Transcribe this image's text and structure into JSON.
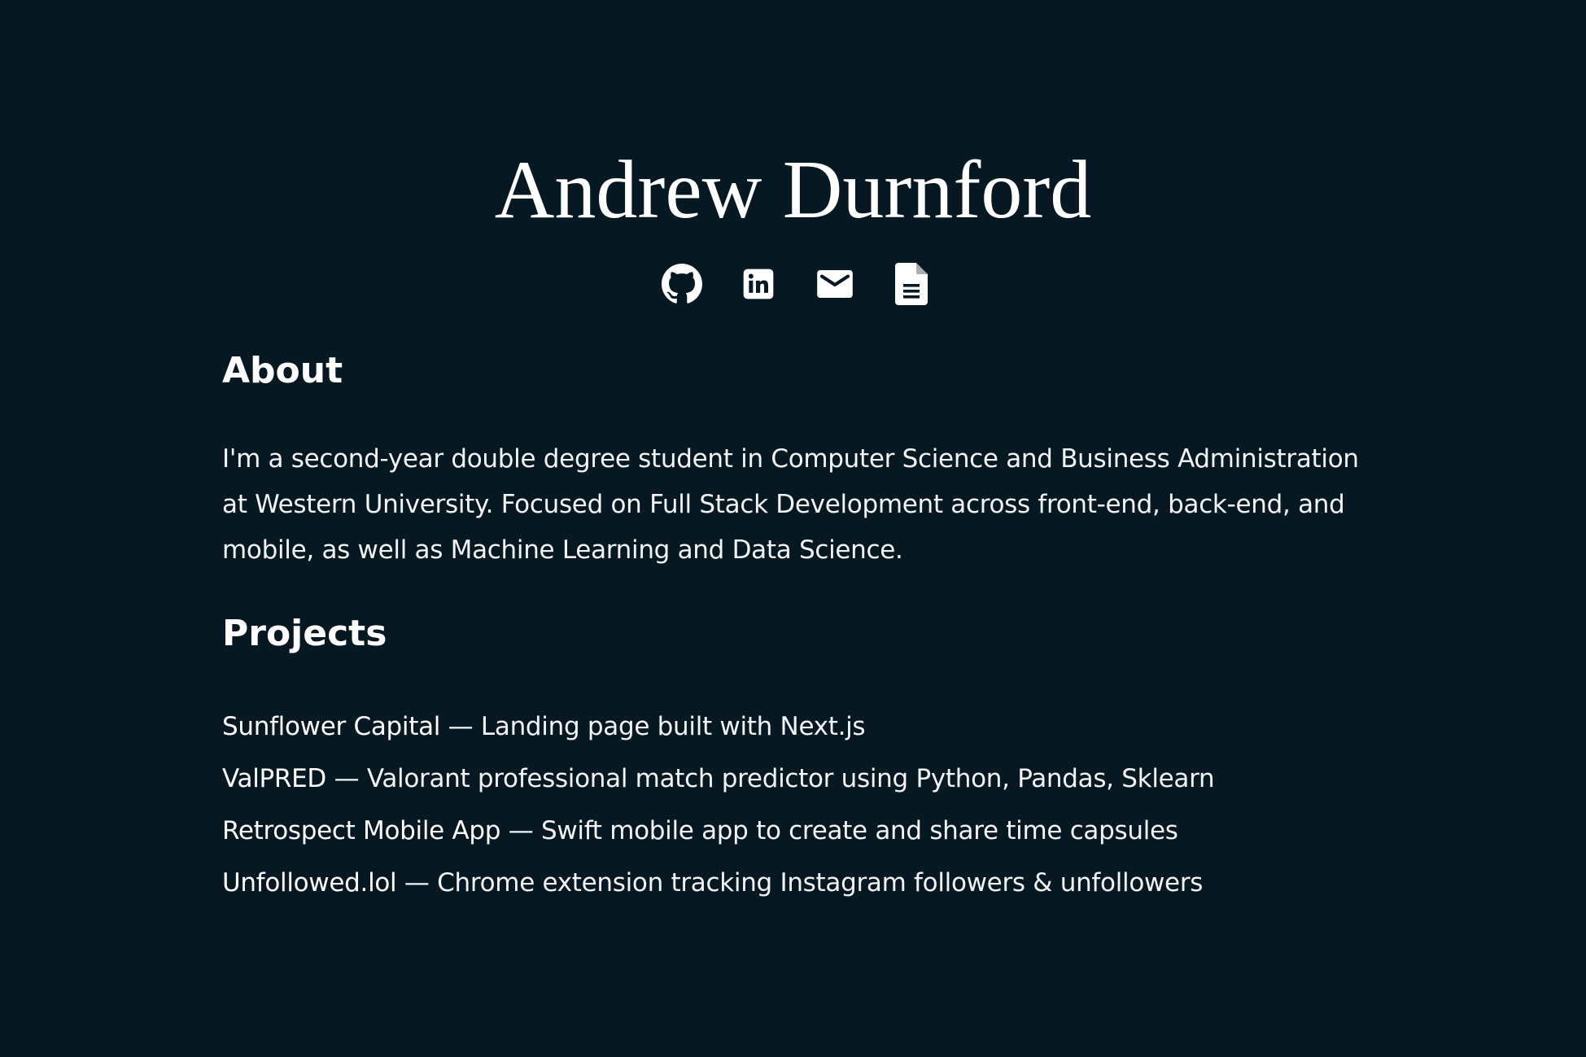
{
  "header": {
    "name": "Andrew Durnford"
  },
  "socials": [
    {
      "icon": "github-icon",
      "label": "GitHub"
    },
    {
      "icon": "linkedin-icon",
      "label": "LinkedIn"
    },
    {
      "icon": "mail-icon",
      "label": "Email"
    },
    {
      "icon": "document-icon",
      "label": "Resume"
    }
  ],
  "about": {
    "title": "About",
    "text": "I'm a second-year double degree student in Computer Science and Business Administration at Western University. Focused on Full Stack Development across front-end, back-end, and mobile, as well as Machine Learning and Data Science."
  },
  "projects": {
    "title": "Projects",
    "separator": " — ",
    "items": [
      {
        "name": "Sunflower Capital",
        "description": "Landing page built with Next.js"
      },
      {
        "name": "ValPRED",
        "description": "Valorant professional match predictor using Python, Pandas, Sklearn"
      },
      {
        "name": "Retrospect Mobile App",
        "description": "Swift mobile app to create and share time capsules"
      },
      {
        "name": "Unfollowed.lol",
        "description": "Chrome extension tracking Instagram followers & unfollowers"
      }
    ]
  },
  "colors": {
    "background": "#061821",
    "text": "#ffffff"
  }
}
